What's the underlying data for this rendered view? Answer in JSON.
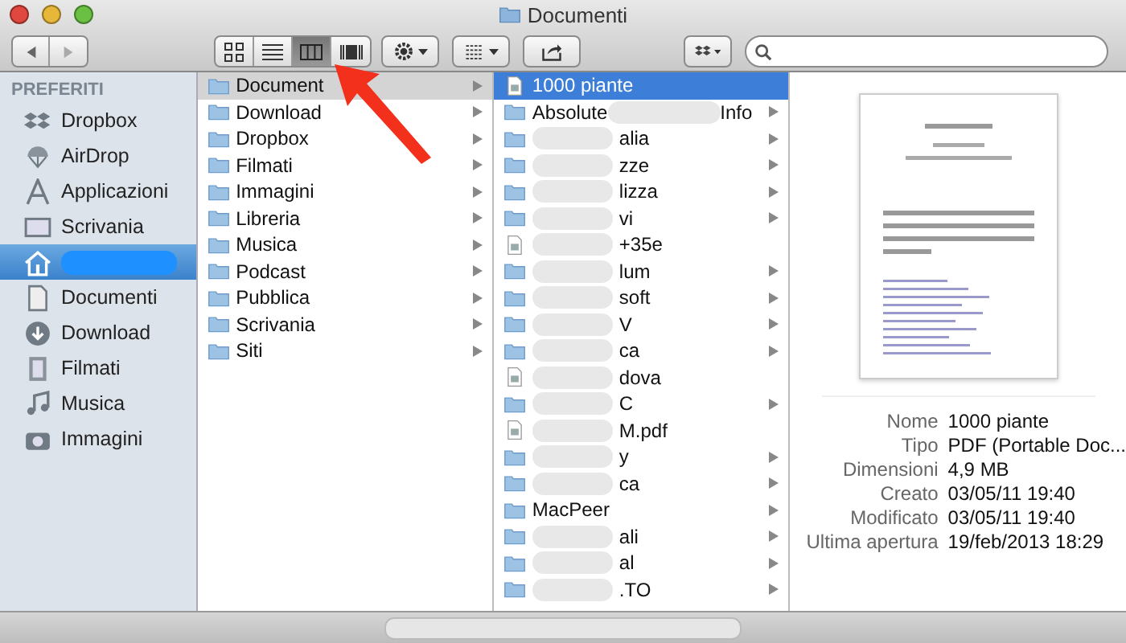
{
  "window": {
    "title": "Documenti"
  },
  "toolbar": {
    "views": [
      {
        "kind": "icons",
        "selected": false
      },
      {
        "kind": "list",
        "selected": false
      },
      {
        "kind": "columns",
        "selected": true
      },
      {
        "kind": "coverflow",
        "selected": false
      }
    ]
  },
  "sidebar": {
    "heading": "PREFERITI",
    "items": [
      {
        "label": "Dropbox",
        "selected": false,
        "redacted": false
      },
      {
        "label": "AirDrop",
        "selected": false,
        "redacted": false
      },
      {
        "label": "Applicazioni",
        "selected": false,
        "redacted": false
      },
      {
        "label": "Scrivania",
        "selected": false,
        "redacted": false
      },
      {
        "selected": true,
        "redacted": true
      },
      {
        "label": "Documenti",
        "selected": false,
        "redacted": false
      },
      {
        "label": "Download",
        "selected": false,
        "redacted": false
      },
      {
        "label": "Filmati",
        "selected": false,
        "redacted": false
      },
      {
        "label": "Musica",
        "selected": false,
        "redacted": false
      },
      {
        "label": "Immagini",
        "selected": false,
        "redacted": false
      }
    ]
  },
  "column_1": [
    {
      "label": "Document",
      "selected": true
    },
    {
      "label": "Download",
      "selected": false
    },
    {
      "label": "Dropbox",
      "selected": false
    },
    {
      "label": "Filmati",
      "selected": false
    },
    {
      "label": "Immagini",
      "selected": false
    },
    {
      "label": "Libreria",
      "selected": false
    },
    {
      "label": "Musica",
      "selected": false
    },
    {
      "label": "Podcast",
      "selected": false
    },
    {
      "label": "Pubblica",
      "selected": false
    },
    {
      "label": "Scrivania",
      "selected": false
    },
    {
      "label": "Siti",
      "selected": false
    }
  ],
  "column_2": [
    {
      "kind": "file",
      "label": "1000 piante",
      "selected": true,
      "redacted": false
    },
    {
      "kind": "folder",
      "label": "Absolute",
      "tail": "Info",
      "selected": false,
      "redacted": true
    },
    {
      "kind": "folder",
      "label": "alia",
      "selected": false,
      "redacted": true
    },
    {
      "kind": "folder",
      "label": "zze",
      "selected": false,
      "redacted": true
    },
    {
      "kind": "folder",
      "label": "lizza",
      "selected": false,
      "redacted": true
    },
    {
      "kind": "folder",
      "label": "vi",
      "selected": false,
      "redacted": true
    },
    {
      "kind": "file",
      "label": "+35e",
      "selected": false,
      "redacted": true
    },
    {
      "kind": "folder",
      "label": "lum",
      "selected": false,
      "redacted": true
    },
    {
      "kind": "folder",
      "label": "soft",
      "selected": false,
      "redacted": true
    },
    {
      "kind": "folder",
      "label": "V",
      "selected": false,
      "redacted": true
    },
    {
      "kind": "folder",
      "label": "ca",
      "selected": false,
      "redacted": true
    },
    {
      "kind": "file",
      "label": "dova",
      "selected": false,
      "redacted": true
    },
    {
      "kind": "folder",
      "label": "C",
      "selected": false,
      "redacted": true
    },
    {
      "kind": "file",
      "label": "M.pdf",
      "selected": false,
      "redacted": true
    },
    {
      "kind": "folder",
      "label": "y",
      "selected": false,
      "redacted": true
    },
    {
      "kind": "folder",
      "label": "ca",
      "selected": false,
      "redacted": true
    },
    {
      "kind": "folder",
      "label": "MacPeer",
      "selected": false,
      "redacted": false
    },
    {
      "kind": "folder",
      "label": "ali",
      "selected": false,
      "redacted": true
    },
    {
      "kind": "folder",
      "label": "al",
      "selected": false,
      "redacted": true
    },
    {
      "kind": "folder",
      "label": ".TO",
      "selected": false,
      "redacted": true
    }
  ],
  "preview": {
    "info": [
      {
        "label": "Nome",
        "value": "1000 piante"
      },
      {
        "label": "Tipo",
        "value": "PDF (Portable Doc..."
      },
      {
        "label": "Dimensioni",
        "value": "4,9 MB"
      },
      {
        "label": "Creato",
        "value": "03/05/11 19:40"
      },
      {
        "label": "Modificato",
        "value": "03/05/11 19:40"
      },
      {
        "label": "Ultima apertura",
        "value": "19/feb/2013 18:29"
      }
    ]
  }
}
